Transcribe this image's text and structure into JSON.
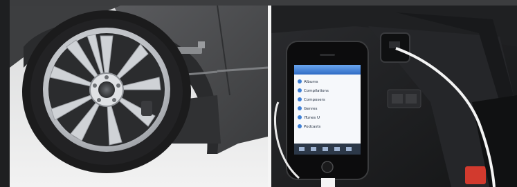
{
  "images": {
    "left": {
      "subject": "alloy-wheel-and-badge"
    },
    "right": {
      "subject": "phone-connected-by-usb-in-console"
    }
  },
  "phone_screen": {
    "menu_items": [
      "Albums",
      "Compilations",
      "Composers",
      "Genres",
      "iTunes U",
      "Podcasts"
    ]
  },
  "colors": {
    "car_body": "#4a4b4d",
    "wheel_silver": "#c9ccd0",
    "tyre": "#1b1b1c",
    "console": "#1c1d1f",
    "screen_blue": "#3d7fd6",
    "cable_white": "#f4f4f4",
    "red_button": "#d23a2e"
  }
}
